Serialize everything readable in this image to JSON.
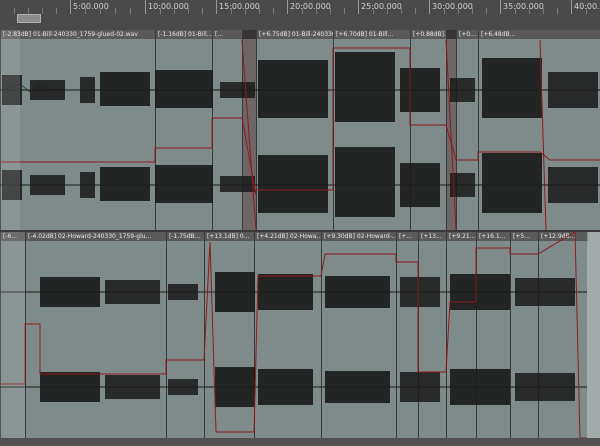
{
  "ruler": {
    "ticks": [
      "5:00.000",
      "10:00.000",
      "15:00.000",
      "20:00.000",
      "25:00.000",
      "30:00.000",
      "35:00.000",
      "40:00.000"
    ]
  },
  "track1": {
    "clips": [
      {
        "label": "[-2.83dB] 01-Bill-240330_1759-glued-02.wav"
      },
      {
        "label": "[-1.16dB] 01-Bill..."
      },
      {
        "label": "[..."
      },
      {
        "label": "[+6.75dB] 01-Bill-240330_17..."
      },
      {
        "label": "[+6.70dB] 01-Bill..."
      },
      {
        "label": "[+0.88dB]..."
      },
      {
        "label": "[+0..."
      },
      {
        "label": "[+6.48dB..."
      }
    ]
  },
  "track2": {
    "clips": [
      {
        "label": "[-6..."
      },
      {
        "label": "[-4.02dB] 02-Howard-240330_1759-glu..."
      },
      {
        "label": "[-1.75dB..."
      },
      {
        "label": "[+13.1dB] 0..."
      },
      {
        "label": "[+4.21dB] 02-Howa..."
      },
      {
        "label": "[+9.30dB] 02-Howard-..."
      },
      {
        "label": "[+..."
      },
      {
        "label": "[+13..."
      },
      {
        "label": "[+9.21..."
      },
      {
        "label": "[+16.1..."
      },
      {
        "label": "[+5..."
      },
      {
        "label": "[+12.9dB..."
      }
    ]
  }
}
